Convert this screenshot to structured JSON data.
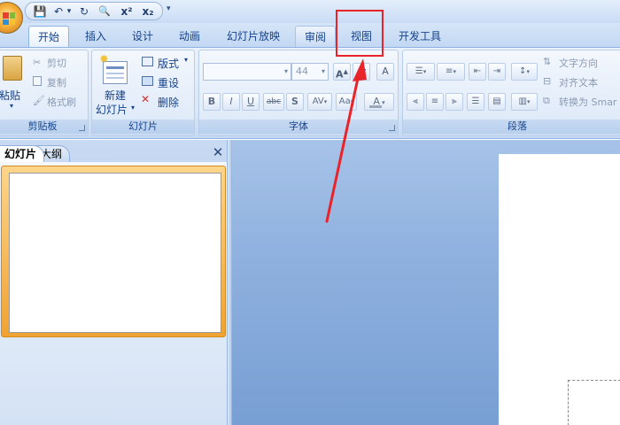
{
  "quick_access": {
    "buttons": [
      {
        "name": "save-icon",
        "label": "💾"
      },
      {
        "name": "undo-icon",
        "label": "↶"
      },
      {
        "name": "undo-dropdown-icon",
        "label": "▾"
      },
      {
        "name": "redo-icon",
        "label": "↻"
      },
      {
        "name": "print-preview-icon",
        "label": "🔍"
      },
      {
        "name": "superscript-icon",
        "label": "x²"
      },
      {
        "name": "subscript-icon",
        "label": "x₂"
      }
    ],
    "customize": "▾"
  },
  "tabs": [
    {
      "label": "开始",
      "state": "active"
    },
    {
      "label": "插入"
    },
    {
      "label": "设计"
    },
    {
      "label": "动画"
    },
    {
      "label": "幻灯片放映"
    },
    {
      "label": "审阅",
      "state": "hover"
    },
    {
      "label": "视图",
      "state": "highlighted"
    },
    {
      "label": "开发工具"
    }
  ],
  "ribbon": {
    "clipboard": {
      "label": "剪贴板",
      "paste": "粘贴",
      "cut": "剪切",
      "copy": "复制",
      "format_painter": "格式刷"
    },
    "slides": {
      "label": "幻灯片",
      "new_slide_line1": "新建",
      "new_slide_line2": "幻灯片",
      "layout": "版式",
      "reset": "重设",
      "delete": "删除"
    },
    "font": {
      "label": "字体",
      "font_name": "",
      "font_size": "44",
      "grow": "A",
      "shrink": "A",
      "clear": "A",
      "bold": "B",
      "italic": "I",
      "underline": "U",
      "strike": "abc",
      "shadow": "S",
      "spacing": "AV",
      "case": "Aa",
      "color": "A"
    },
    "paragraph": {
      "label": "段落",
      "text_direction": "文字方向",
      "align_text": "对齐文本",
      "convert_smartart": "转换为 Smar"
    }
  },
  "panel": {
    "tab_slides": "幻灯片",
    "tab_outline": "大纲",
    "close": "✕"
  },
  "colors": {
    "accent": "#15428b",
    "highlight": "#e8232a",
    "selection": "#f1a332"
  }
}
